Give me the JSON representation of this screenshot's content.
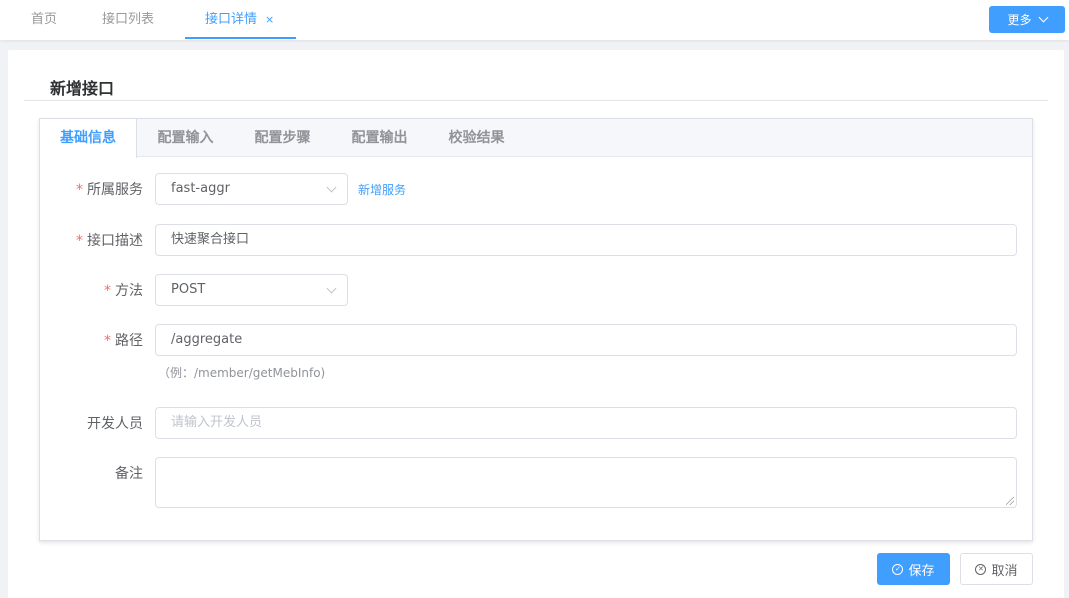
{
  "top_tabs": [
    {
      "label": "首页"
    },
    {
      "label": "接口列表"
    },
    {
      "label": "接口详情",
      "close": "×"
    }
  ],
  "more_button": {
    "label": "更多"
  },
  "page": {
    "title": "新增接口"
  },
  "form_tabs": [
    {
      "label": "基础信息"
    },
    {
      "label": "配置输入"
    },
    {
      "label": "配置步骤"
    },
    {
      "label": "配置输出"
    },
    {
      "label": "校验结果"
    }
  ],
  "form": {
    "required_mark": "*",
    "service": {
      "label": "所属服务",
      "value": "fast-aggr",
      "add_link": "新增服务"
    },
    "description": {
      "label": "接口描述",
      "value": "快速聚合接口"
    },
    "method": {
      "label": "方法",
      "value": "POST"
    },
    "path": {
      "label": "路径",
      "value": "/aggregate",
      "hint": "（例：/member/getMebInfo)"
    },
    "developer": {
      "label": "开发人员",
      "placeholder": "请输入开发人员"
    },
    "remark": {
      "label": "备注",
      "value": ""
    }
  },
  "footer": {
    "save_label": "保存",
    "cancel_label": "取消"
  },
  "colors": {
    "accent": "#409eff",
    "required": "#f56c6c"
  }
}
